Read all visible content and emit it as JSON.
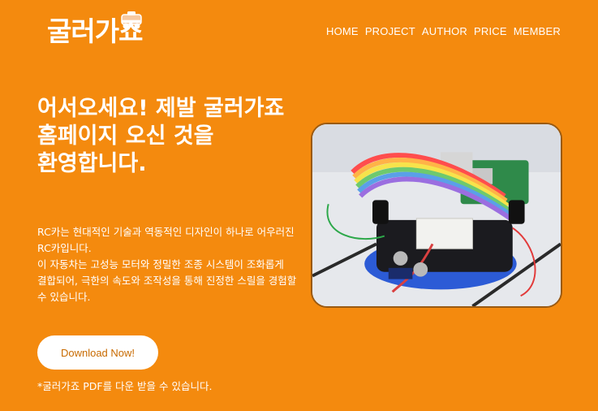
{
  "brand": {
    "logo_text": "굴러가죠"
  },
  "nav": {
    "items": [
      {
        "label": "HOME"
      },
      {
        "label": "PROJECT"
      },
      {
        "label": "AUTHOR"
      },
      {
        "label": "PRICE"
      },
      {
        "label": "MEMBER"
      }
    ]
  },
  "hero": {
    "headline": "어서오세요! 제발 굴러가죠 홈페이지 오신 것을 환영합니다.",
    "description_line1": "RC카는 현대적인 기술과 역동적인 디자인이 하나로 어우러진 RC카입니다.",
    "description_line2": "이 자동차는 고성능 모터와 정밀한 조종 시스템이 조화롭게 결합되어, 극한의 속도와 조작성을 통해 진정한 스릴을 경험할 수 있습니다.",
    "download_label": "Download Now!",
    "note": "*굴러가죠 PDF를 다운 받을 수 있습니다."
  },
  "colors": {
    "background": "#F48A0E",
    "button_text": "#C86A00"
  }
}
